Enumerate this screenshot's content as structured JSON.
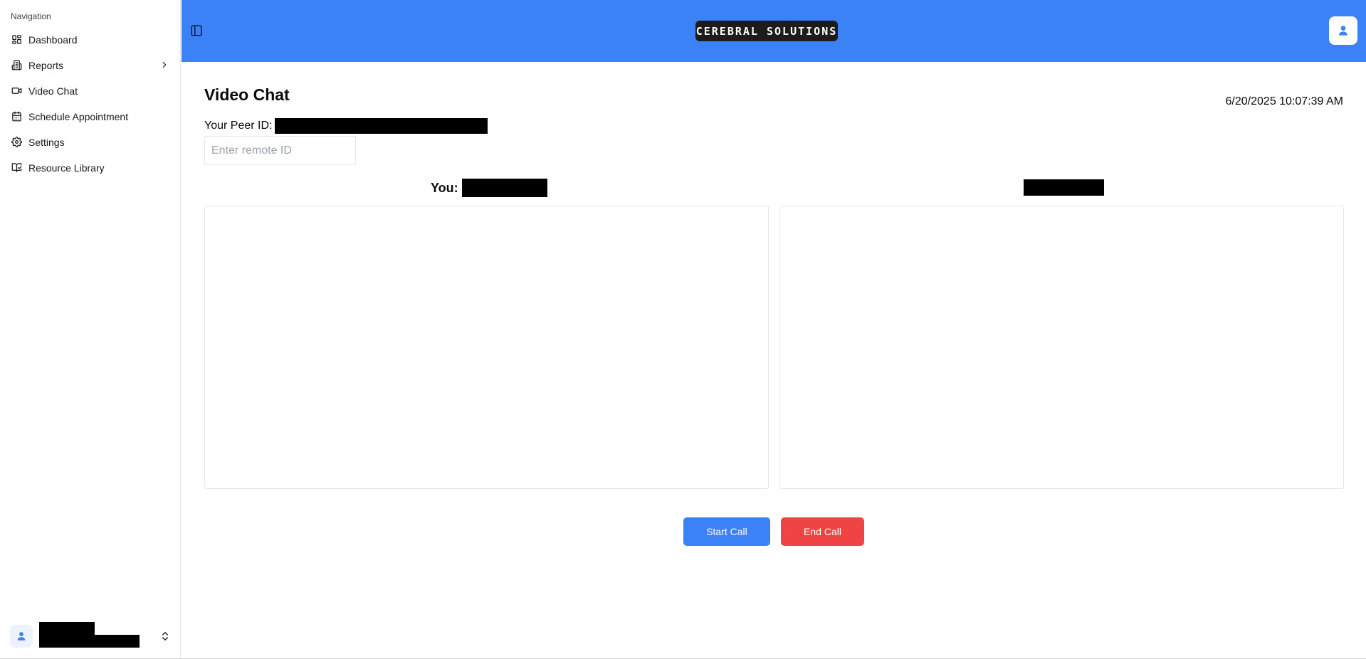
{
  "sidebar": {
    "heading": "Navigation",
    "items": [
      {
        "label": "Dashboard",
        "icon": "dashboard-icon"
      },
      {
        "label": "Reports",
        "icon": "reports-icon",
        "has_submenu": true
      },
      {
        "label": "Video Chat",
        "icon": "video-icon"
      },
      {
        "label": "Schedule Appointment",
        "icon": "calendar-icon"
      },
      {
        "label": "Settings",
        "icon": "gear-icon"
      },
      {
        "label": "Resource Library",
        "icon": "library-icon"
      }
    ]
  },
  "header": {
    "logo_text": "CEREBRAL SOLUTIONS",
    "background": "#3b82f6"
  },
  "main": {
    "title": "Video Chat",
    "datetime": "6/20/2025 10:07:39 AM",
    "peer_id_label": "Your Peer ID:",
    "remote_input_placeholder": "Enter remote ID",
    "remote_input_value": "",
    "you_label": "You:",
    "start_call_label": "Start Call",
    "end_call_label": "End Call"
  },
  "colors": {
    "accent": "#3b82f6",
    "danger": "#ef4444",
    "logo_bg": "#1c1c1c"
  }
}
